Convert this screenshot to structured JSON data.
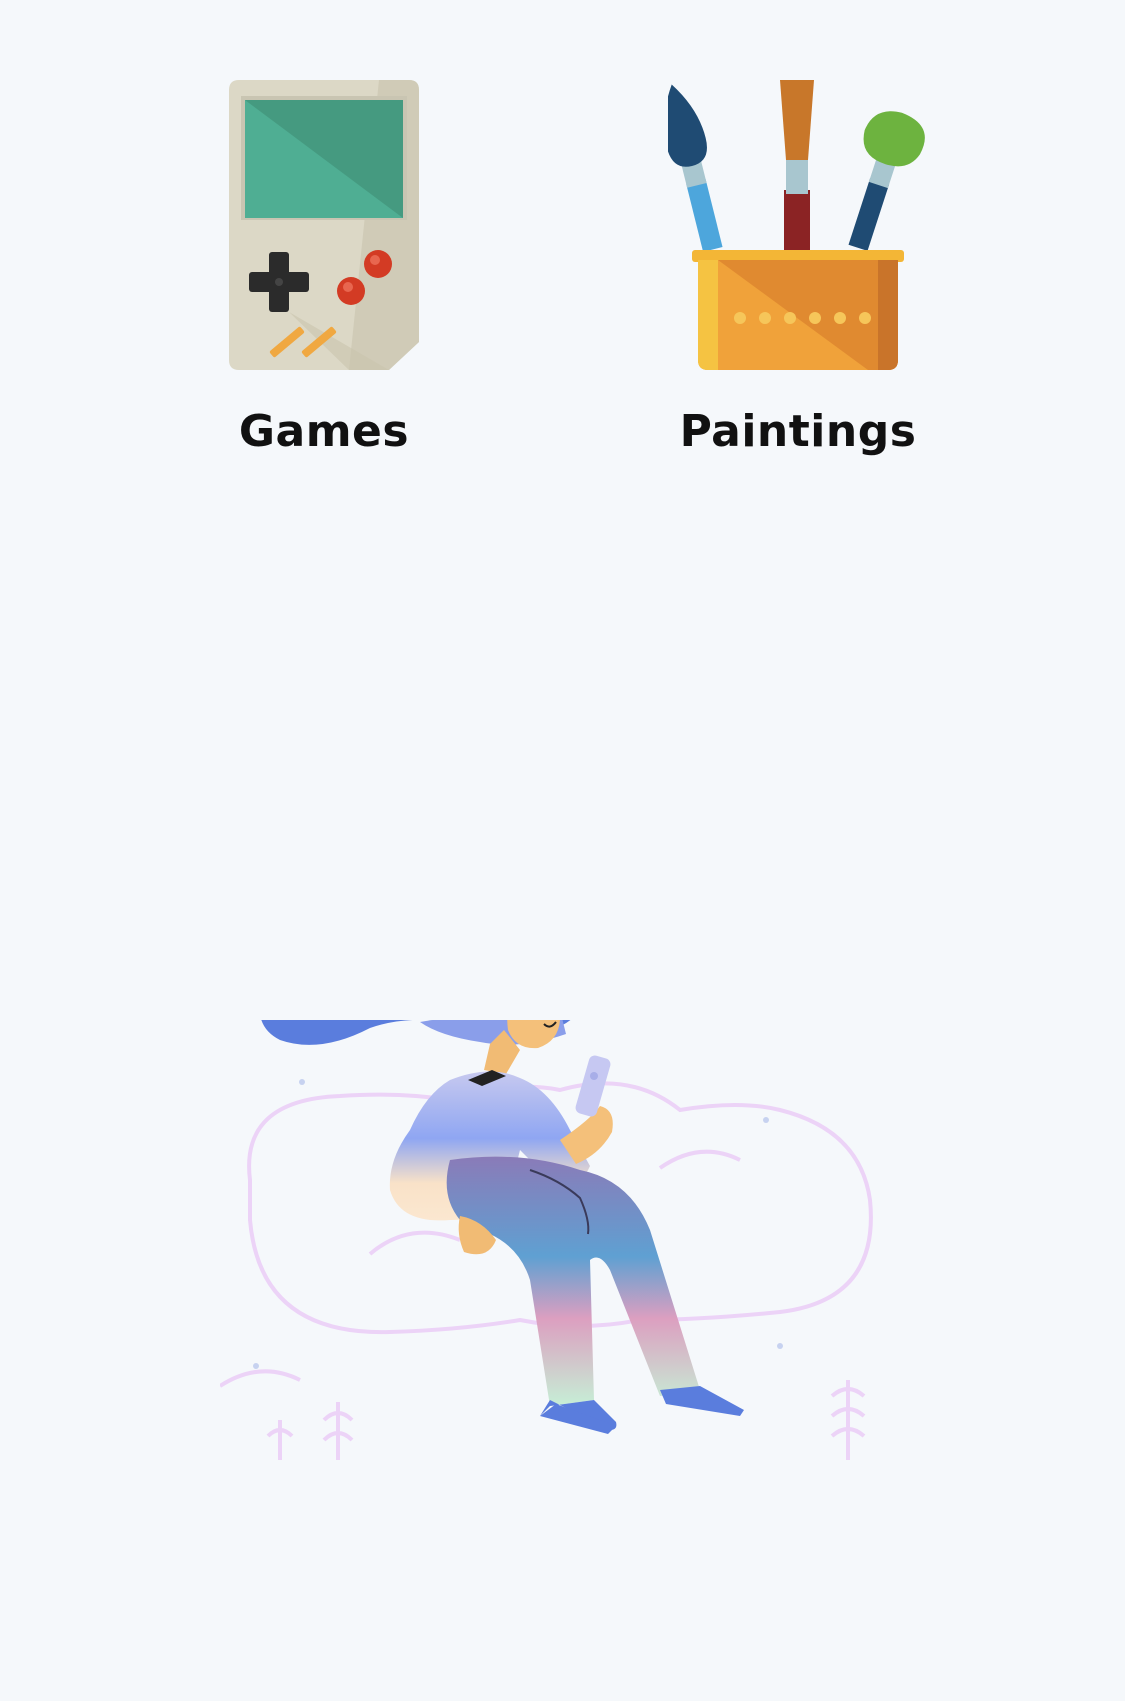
{
  "categories": [
    {
      "id": "games",
      "label": "Games",
      "icon": "game-console-icon"
    },
    {
      "id": "paintings",
      "label": "Paintings",
      "icon": "paintbrush-cup-icon"
    }
  ],
  "illustration": {
    "icon": "woman-with-phone-illustration"
  },
  "colors": {
    "background": "#f5f8fb",
    "text": "#111111",
    "console_body": "#dcd8c6",
    "console_screen": "#4ea88f",
    "cup": "#ec9a38",
    "hair": "#5a7ddd",
    "cloud_outline": "#ecd3f7"
  }
}
